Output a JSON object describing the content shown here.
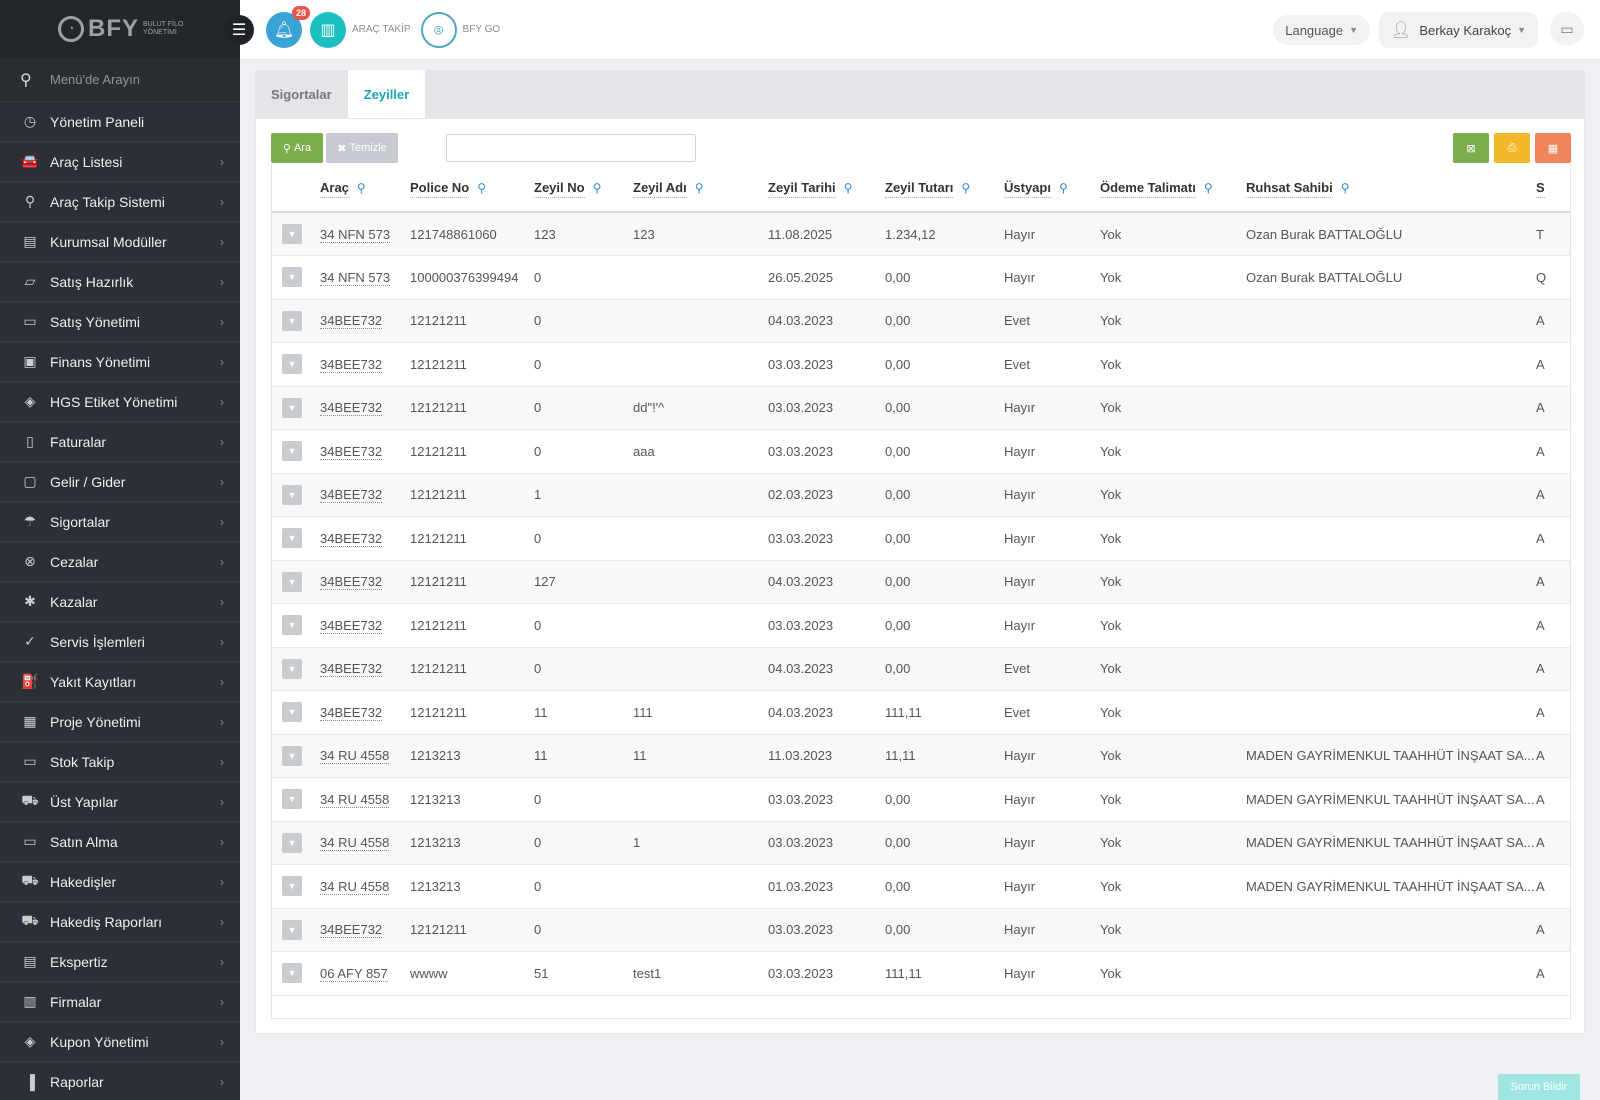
{
  "brand": {
    "name": "BFY",
    "tagline": "BULUT FİLO YÖNETİMİ"
  },
  "sidebar": {
    "search_placeholder": "Menü'de Arayın",
    "items": [
      {
        "label": "Yönetim Paneli",
        "icon": "dashboard-icon",
        "glyph": "◷",
        "chevron": false
      },
      {
        "label": "Araç Listesi",
        "icon": "car-icon",
        "glyph": "🚘",
        "chevron": true
      },
      {
        "label": "Araç Takip Sistemi",
        "icon": "location-pin-icon",
        "glyph": "⚲",
        "chevron": true
      },
      {
        "label": "Kurumsal Modüller",
        "icon": "server-icon",
        "glyph": "▤",
        "chevron": true
      },
      {
        "label": "Satış Hazırlık",
        "icon": "book-icon",
        "glyph": "▱",
        "chevron": true
      },
      {
        "label": "Satış Yönetimi",
        "icon": "credit-card-icon",
        "glyph": "▭",
        "chevron": true
      },
      {
        "label": "Finans Yönetimi",
        "icon": "money-icon",
        "glyph": "▣",
        "chevron": true
      },
      {
        "label": "HGS Etiket Yönetimi",
        "icon": "tag-icon",
        "glyph": "◈",
        "chevron": true
      },
      {
        "label": "Faturalar",
        "icon": "file-icon",
        "glyph": "▯",
        "chevron": true
      },
      {
        "label": "Gelir / Gider",
        "icon": "wallet-icon",
        "glyph": "▢",
        "chevron": true
      },
      {
        "label": "Sigortalar",
        "icon": "umbrella-icon",
        "glyph": "☂",
        "chevron": true
      },
      {
        "label": "Cezalar",
        "icon": "cancel-circle-icon",
        "glyph": "⊗",
        "chevron": true
      },
      {
        "label": "Kazalar",
        "icon": "car-crash-icon",
        "glyph": "✱",
        "chevron": true
      },
      {
        "label": "Servis İşlemleri",
        "icon": "check-circle-icon",
        "glyph": "✓",
        "chevron": true
      },
      {
        "label": "Yakıt Kayıtları",
        "icon": "fuel-icon",
        "glyph": "⛽",
        "chevron": true
      },
      {
        "label": "Proje Yönetimi",
        "icon": "briefcase-icon",
        "glyph": "▦",
        "chevron": true
      },
      {
        "label": "Stok Takip",
        "icon": "inbox-icon",
        "glyph": "▭",
        "chevron": true
      },
      {
        "label": "Üst Yapılar",
        "icon": "truck-icon",
        "glyph": "⛟",
        "chevron": true
      },
      {
        "label": "Satın Alma",
        "icon": "credit-card-icon",
        "glyph": "▭",
        "chevron": true
      },
      {
        "label": "Hakedişler",
        "icon": "truck-icon",
        "glyph": "⛟",
        "chevron": true
      },
      {
        "label": "Hakediş Raporları",
        "icon": "truck-icon",
        "glyph": "⛟",
        "chevron": true
      },
      {
        "label": "Ekspertiz",
        "icon": "clipboard-icon",
        "glyph": "▤",
        "chevron": true
      },
      {
        "label": "Firmalar",
        "icon": "building-icon",
        "glyph": "▥",
        "chevron": true
      },
      {
        "label": "Kupon Yönetimi",
        "icon": "ticket-icon",
        "glyph": "◈",
        "chevron": true
      },
      {
        "label": "Raporlar",
        "icon": "bar-chart-icon",
        "glyph": "▐",
        "chevron": true
      }
    ]
  },
  "topbar": {
    "notification_count": "28",
    "arac_takip": "ARAÇ TAKİP",
    "bfy_go": "BFY GO",
    "language": "Language",
    "user_name": "Berkay Karakoç"
  },
  "tabs": [
    {
      "label": "Sigortalar",
      "active": false
    },
    {
      "label": "Zeyiller",
      "active": true
    }
  ],
  "toolbar": {
    "search_label": "Ara",
    "clear_label": "Temizle",
    "search_value": ""
  },
  "table": {
    "columns": [
      "Araç",
      "Police No",
      "Zeyil No",
      "Zeyil Adı",
      "Zeyil Tarihi",
      "Zeyil Tutarı",
      "Üstyapı",
      "Ödeme Talimatı",
      "Ruhsat Sahibi",
      "S"
    ],
    "rows": [
      [
        "34 NFN 573",
        "121748861060",
        "123",
        "123",
        "11.08.2025",
        "1.234,12",
        "Hayır",
        "Yok",
        "Ozan Burak BATTALOĞLU",
        "T"
      ],
      [
        "34 NFN 573",
        "100000376399494",
        "0",
        "",
        "26.05.2025",
        "0,00",
        "Hayır",
        "Yok",
        "Ozan Burak BATTALOĞLU",
        "Q"
      ],
      [
        "34BEE732",
        "12121211",
        "0",
        "",
        "04.03.2023",
        "0,00",
        "Evet",
        "Yok",
        "",
        "A"
      ],
      [
        "34BEE732",
        "12121211",
        "0",
        "",
        "03.03.2023",
        "0,00",
        "Evet",
        "Yok",
        "",
        "A"
      ],
      [
        "34BEE732",
        "12121211",
        "0",
        "dd\"!'^",
        "03.03.2023",
        "0,00",
        "Hayır",
        "Yok",
        "",
        "A"
      ],
      [
        "34BEE732",
        "12121211",
        "0",
        "aaa",
        "03.03.2023",
        "0,00",
        "Hayır",
        "Yok",
        "",
        "A"
      ],
      [
        "34BEE732",
        "12121211",
        "1",
        "",
        "02.03.2023",
        "0,00",
        "Hayır",
        "Yok",
        "",
        "A"
      ],
      [
        "34BEE732",
        "12121211",
        "0",
        "",
        "03.03.2023",
        "0,00",
        "Hayır",
        "Yok",
        "",
        "A"
      ],
      [
        "34BEE732",
        "12121211",
        "127",
        "",
        "04.03.2023",
        "0,00",
        "Hayır",
        "Yok",
        "",
        "A"
      ],
      [
        "34BEE732",
        "12121211",
        "0",
        "",
        "03.03.2023",
        "0,00",
        "Hayır",
        "Yok",
        "",
        "A"
      ],
      [
        "34BEE732",
        "12121211",
        "0",
        "",
        "04.03.2023",
        "0,00",
        "Evet",
        "Yok",
        "",
        "A"
      ],
      [
        "34BEE732",
        "12121211",
        "11",
        "111",
        "04.03.2023",
        "111,11",
        "Evet",
        "Yok",
        "",
        "A"
      ],
      [
        "34 RU 4558",
        "1213213",
        "11",
        "11",
        "11.03.2023",
        "11,11",
        "Hayır",
        "Yok",
        "MADEN GAYRİMENKUL TAAHHÜT İNŞAAT SA...",
        "A"
      ],
      [
        "34 RU 4558",
        "1213213",
        "0",
        "",
        "03.03.2023",
        "0,00",
        "Hayır",
        "Yok",
        "MADEN GAYRİMENKUL TAAHHÜT İNŞAAT SA...",
        "A"
      ],
      [
        "34 RU 4558",
        "1213213",
        "0",
        "1",
        "03.03.2023",
        "0,00",
        "Hayır",
        "Yok",
        "MADEN GAYRİMENKUL TAAHHÜT İNŞAAT SA...",
        "A"
      ],
      [
        "34 RU 4558",
        "1213213",
        "0",
        "",
        "01.03.2023",
        "0,00",
        "Hayır",
        "Yok",
        "MADEN GAYRİMENKUL TAAHHÜT İNŞAAT SA...",
        "A"
      ],
      [
        "34BEE732",
        "12121211",
        "0",
        "",
        "03.03.2023",
        "0,00",
        "Hayır",
        "Yok",
        "",
        "A"
      ],
      [
        "06 AFY 857",
        "wwww",
        "51",
        "test1",
        "03.03.2023",
        "111,11",
        "Hayır",
        "Yok",
        "",
        "A"
      ]
    ]
  },
  "report_button": "Sorun Bildir",
  "colors": {
    "sidebar_bg": "#2c3036",
    "accent": "#1aa8b7",
    "success": "#7cae4b",
    "warning": "#f3b72b",
    "danger": "#f0845b"
  }
}
